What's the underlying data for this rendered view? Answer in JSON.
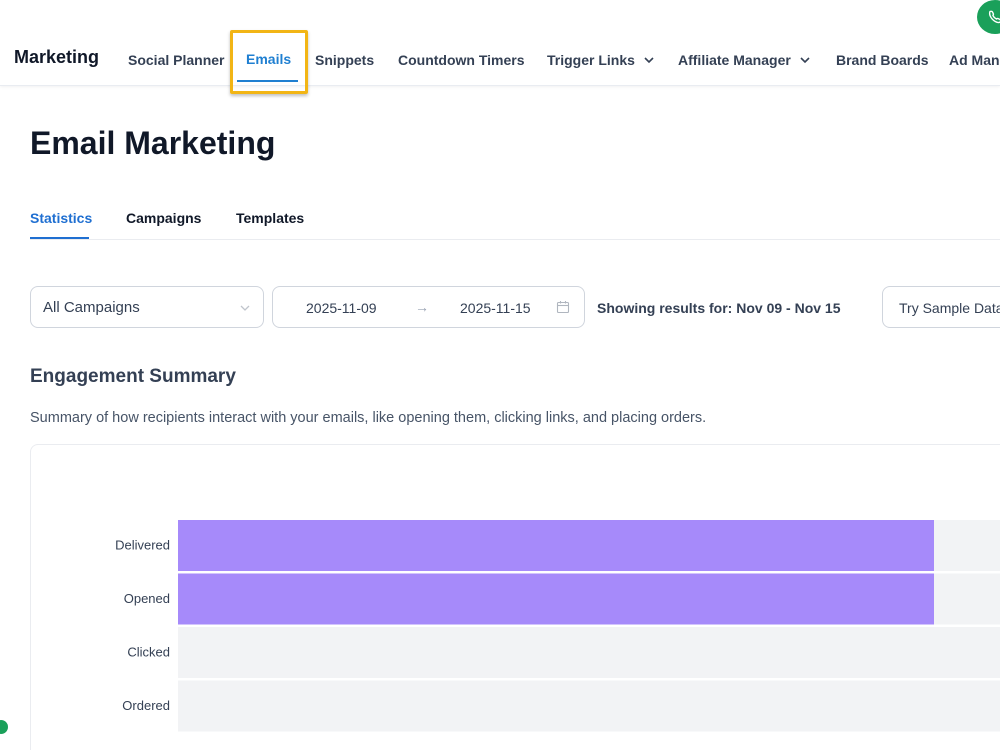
{
  "nav": {
    "brand": "Marketing",
    "items": [
      {
        "label": "Social Planner"
      },
      {
        "label": "Emails"
      },
      {
        "label": "Snippets"
      },
      {
        "label": "Countdown Timers"
      },
      {
        "label": "Trigger Links"
      },
      {
        "label": "Affiliate Manager"
      },
      {
        "label": "Brand Boards"
      },
      {
        "label": "Ad Man"
      }
    ],
    "active_item": "Emails",
    "highlight_color": "#f2b515",
    "phone_icon": "phone-icon"
  },
  "page": {
    "title": "Email Marketing",
    "tabs": [
      {
        "label": "Statistics"
      },
      {
        "label": "Campaigns"
      },
      {
        "label": "Templates"
      }
    ],
    "active_tab": "Statistics"
  },
  "filters": {
    "campaign_select": "All Campaigns",
    "date_start": "2025-11-09",
    "date_end": "2025-11-15",
    "showing_text": "Showing results for: Nov 09 - Nov 15",
    "sample_button": "Try Sample Data"
  },
  "engagement": {
    "title": "Engagement Summary",
    "description": "Summary of how recipients interact with your emails, like opening them, clicking links, and placing orders."
  },
  "chart_data": {
    "type": "bar",
    "orientation": "horizontal",
    "categories": [
      "Delivered",
      "Opened",
      "Clicked",
      "Ordered"
    ],
    "values": [
      0.84,
      0.84,
      0,
      0
    ],
    "bar_color": "#a68afa",
    "track_color": "#f2f3f5",
    "grid": false
  }
}
